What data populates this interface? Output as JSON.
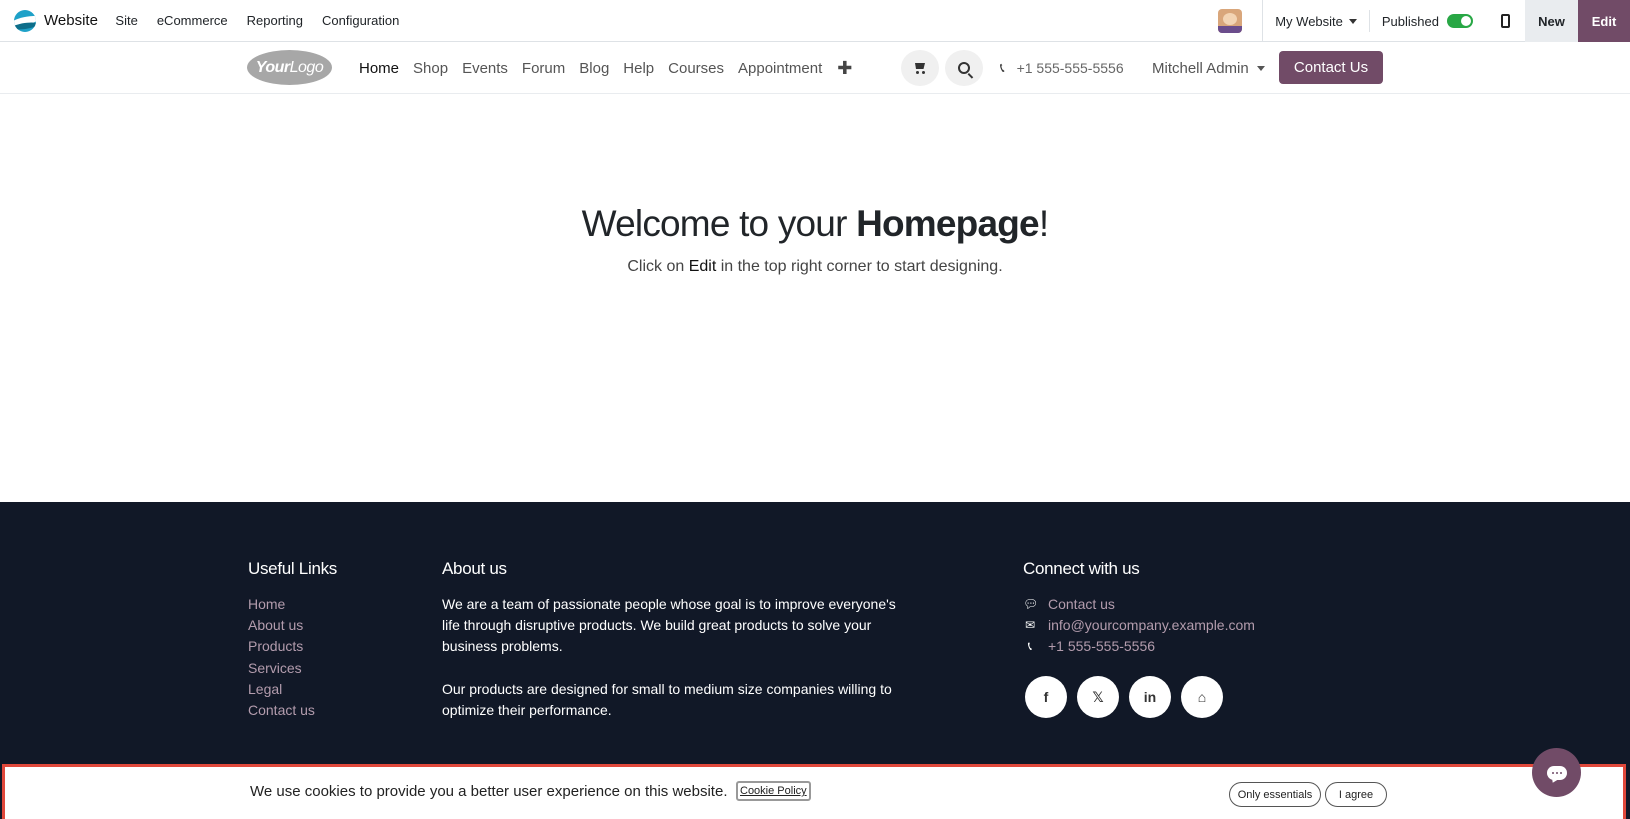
{
  "admin_bar": {
    "brand": "Website",
    "menu": [
      "Site",
      "eCommerce",
      "Reporting",
      "Configuration"
    ],
    "website_selector": "My Website",
    "published_label": "Published",
    "published": true,
    "new_label": "New",
    "edit_label": "Edit"
  },
  "site_header": {
    "logo_bold": "Your",
    "logo_light": "Logo",
    "nav": [
      "Home",
      "Shop",
      "Events",
      "Forum",
      "Blog",
      "Help",
      "Courses",
      "Appointment"
    ],
    "active_nav": "Home",
    "add_symbol": "✚",
    "phone": "+1 555-555-5556",
    "user": "Mitchell Admin",
    "contact_button": "Contact Us"
  },
  "hero": {
    "title_pre": "Welcome to your ",
    "title_bold": "Homepage",
    "title_post": "!",
    "sub_pre": "Click on ",
    "sub_bold": "Edit",
    "sub_post": " in the top right corner to start designing."
  },
  "footer": {
    "links_title": "Useful Links",
    "links": [
      "Home",
      "About us",
      "Products",
      "Services",
      "Legal",
      "Contact us"
    ],
    "about_title": "About us",
    "about_p1": "We are a team of passionate people whose goal is to improve everyone's life through disruptive products. We build great products to solve your business problems.",
    "about_p2": "Our products are designed for small to medium size companies willing to optimize their performance.",
    "connect_title": "Connect with us",
    "connect_contact": "Contact us",
    "connect_email": "info@yourcompany.example.com",
    "connect_phone": "+1 555-555-5556",
    "socials": [
      "f",
      "𝕏",
      "in",
      "⌂"
    ]
  },
  "cookie_bar": {
    "text": "We use cookies to provide you a better user experience on this website.",
    "policy_link": "Cookie Policy",
    "essentials_button": "Only essentials",
    "agree_button": "I agree"
  },
  "colors": {
    "brand_purple": "#714b67",
    "footer_bg": "#111827",
    "footer_link": "#b39cad",
    "highlight_border": "#e0483b"
  }
}
